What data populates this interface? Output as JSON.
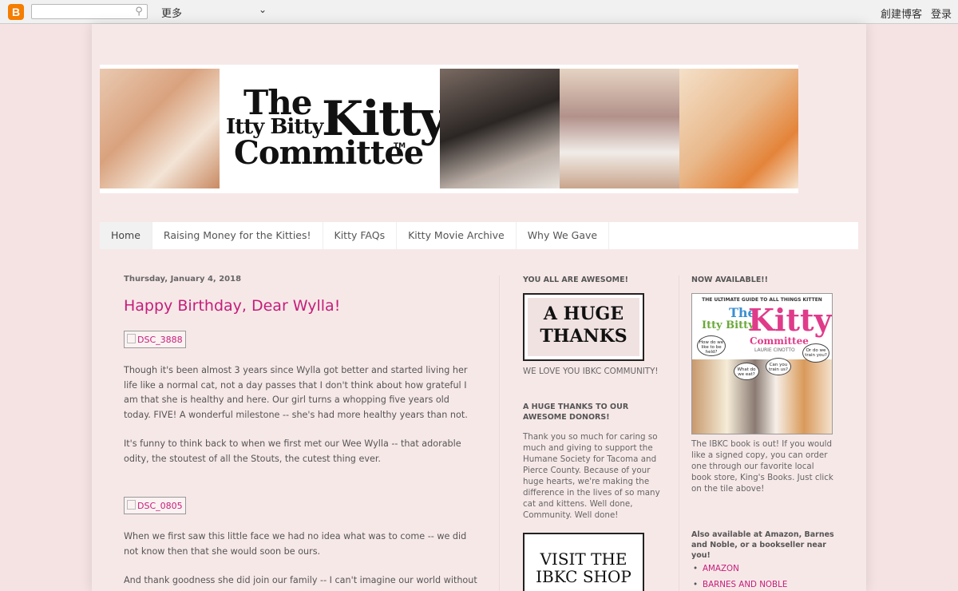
{
  "navbar": {
    "logo_glyph": "B",
    "search_placeholder": "",
    "search_icon": "magnifier-icon",
    "more_label": "更多",
    "create_blog": "創建博客",
    "login": "登录"
  },
  "header": {
    "logo_the": "The",
    "logo_itty": "Itty Bitty",
    "logo_kitty": "Kitty",
    "logo_committee": "Committee",
    "logo_tm": "TM"
  },
  "tabs": [
    "Home",
    "Raising Money for the Kitties!",
    "Kitty FAQs",
    "Kitty Movie Archive",
    "Why We Gave"
  ],
  "post": {
    "date": "Thursday, January 4, 2018",
    "title": "Happy Birthday, Dear Wylla!",
    "img1": "DSC_3888",
    "para1": " Though it's been almost 3 years since Wylla got better and started living her life like a normal cat, not a day passes that I don't think about how grateful I am that she is healthy and here.  Our girl turns a whopping five years old today.  FIVE! A wonderful milestone -- she's had more healthy years than not.",
    "para2": "It's funny to think back to when we first met our Wee Wylla -- that adorable odity, the stoutest of all the Stouts,  the cutest thing ever.",
    "img2": "DSC_0805",
    "para3": "When we first saw this little face we had no idea what was to come -- we did not know then that she would soon be ours.",
    "para4": "And thank goodness she did join our family -- I can't imagine our world without Wylla"
  },
  "sidebar1": {
    "title1": "YOU ALL ARE AWESOME!",
    "thanks_line1": "A HUGE",
    "thanks_line2": "THANKS",
    "caption1": "WE LOVE YOU IBKC COMMUNITY!",
    "title2": "A HUGE THANKS TO OUR AWESOME DONORS!",
    "text2": "Thank you so much for caring so much and giving to support the Humane Society for Tacoma and Pierce County. Because of your huge hearts, we're making the difference in the lives of so many cat and kittens. Well done, Community. Well done!",
    "shop_line1": "VISIT THE",
    "shop_line2": "IBKC SHOP"
  },
  "sidebar2": {
    "title1": "NOW AVAILABLE!!",
    "book_top": "THE ULTIMATE GUIDE TO ALL THINGS KITTEN",
    "book_the": "The",
    "book_itty": "Itty Bitty",
    "book_kitty": "Kitty",
    "book_comm": "Committee",
    "book_author": "LAURIE CINOTTO",
    "bubble1": "How do we like to be held?",
    "bubble2": "What do we eat?",
    "bubble3": "Can you train us?",
    "bubble4": "Or do we train you?",
    "text1": "The IBKC book is out! If you would like a signed copy, you can order one through our favorite local book store, King's Books. Just click on the tile above!",
    "title2": "Also available at Amazon, Barnes and Noble, or a bookseller near you!",
    "links": [
      "AMAZON",
      "BARNES AND NOBLE"
    ]
  },
  "colors": {
    "background": "#f5e3e3",
    "accent": "#c41e7a",
    "page": "#f7e8e8"
  }
}
